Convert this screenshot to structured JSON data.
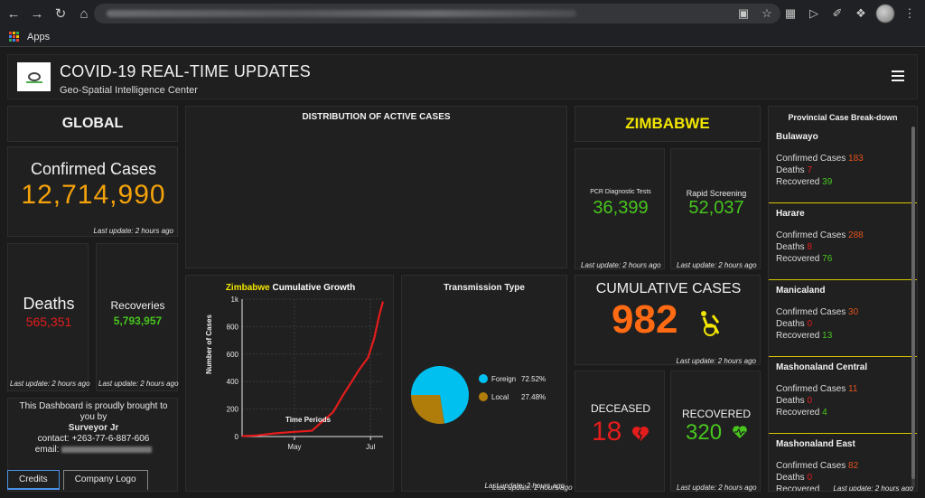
{
  "browser": {
    "apps_label": "Apps",
    "nav_icons": [
      "back-icon",
      "forward-icon",
      "reload-icon",
      "home-icon"
    ]
  },
  "header": {
    "title": "COVID-19 REAL-TIME UPDATES",
    "subtitle": "Geo-Spatial Intelligence Center"
  },
  "global": {
    "title": "GLOBAL",
    "confirmed_label": "Confirmed Cases",
    "confirmed_value": "12,714,990",
    "confirmed_update": "Last update: 2 hours ago",
    "deaths_label": "Deaths",
    "deaths_value": "565,351",
    "deaths_update": "Last update: 2 hours ago",
    "recoveries_label": "Recoveries",
    "recoveries_value": "5,793,957",
    "recoveries_update": "Last update: 2 hours ago"
  },
  "credits": {
    "line1": "This Dashboard is proudly brought to you by",
    "author": "Surveyor Jr",
    "contact": "contact: +263-77-6-887-606",
    "email_label": "email:",
    "tabs": [
      "Credits",
      "Company Logo"
    ]
  },
  "distribution": {
    "title": "DISTRIBUTION OF ACTIVE CASES"
  },
  "growth": {
    "title_highlight": "Zimbabwe",
    "title_rest": "Cumulative Growth",
    "ylabel": "Number of Cases",
    "xlabel": "Time Periods"
  },
  "transmission": {
    "title": "Transmission Type",
    "legend": [
      {
        "label": "Foreign",
        "pct": "72.52%",
        "color": "#00c0f0"
      },
      {
        "label": "Local",
        "pct": "27.48%",
        "color": "#b07d0a"
      }
    ]
  },
  "zimbabwe": {
    "title": "ZIMBABWE",
    "pcr_label": "PCR Diagnostic Tests",
    "pcr_value": "36,399",
    "pcr_update": "Last update: 2 hours ago",
    "rapid_label": "Rapid Screening",
    "rapid_value": "52,037",
    "rapid_update": "Last update: 2 hours ago",
    "cumulative_label": "CUMULATIVE CASES",
    "cumulative_value": "982",
    "cumulative_update": "Last update: 2 hours ago",
    "deceased_label": "DECEASED",
    "deceased_value": "18",
    "deceased_update": "Last update: 2 hours ago",
    "recovered_label": "RECOVERED",
    "recovered_value": "320",
    "recovered_update": "Last update: 2 hours ago",
    "transmission_update": "Last update: 2 hours ago"
  },
  "provincial": {
    "title": "Provincial Case Break-down",
    "confirmed_label": "Confirmed Cases",
    "deaths_label": "Deaths",
    "recovered_label": "Recovered",
    "update": "Last update: 2 hours ago",
    "items": [
      {
        "name": "Bulawayo",
        "confirmed": "183",
        "deaths": "7",
        "recovered": "39"
      },
      {
        "name": "Harare",
        "confirmed": "288",
        "deaths": "8",
        "recovered": "76"
      },
      {
        "name": "Manicaland",
        "confirmed": "30",
        "deaths": "0",
        "recovered": "13"
      },
      {
        "name": "Mashonaland Central",
        "confirmed": "11",
        "deaths": "0",
        "recovered": "4"
      },
      {
        "name": "Mashonaland East",
        "confirmed": "82",
        "deaths": "0",
        "recovered": ""
      }
    ]
  },
  "chart_data": [
    {
      "type": "line",
      "title": "Zimbabwe Cumulative Growth",
      "xlabel": "Time Periods",
      "ylabel": "Number of Cases",
      "x_ticks": [
        "May",
        "Jul"
      ],
      "y_ticks": [
        "0",
        "200",
        "400",
        "600",
        "800",
        "1k"
      ],
      "ylim": [
        0,
        1000
      ],
      "x": [
        "2020-03-20",
        "2020-04-01",
        "2020-04-15",
        "2020-05-01",
        "2020-05-15",
        "2020-06-01",
        "2020-06-08",
        "2020-06-15",
        "2020-06-22",
        "2020-06-29",
        "2020-07-04",
        "2020-07-08",
        "2020-07-11"
      ],
      "xlim": [
        "2020-03-20",
        "2020-07-11"
      ],
      "x_tick_positions": [
        "2020-05-01",
        "2020-07-01"
      ],
      "series": [
        {
          "values": [
            3,
            8,
            23,
            34,
            42,
            178,
            287,
            387,
            489,
            574,
            716,
            885,
            982
          ],
          "color": "#e51c1c"
        }
      ]
    },
    {
      "type": "pie",
      "title": "Transmission Type",
      "categories": [
        "Foreign",
        "Local"
      ],
      "values": [
        72.52,
        27.48
      ],
      "colors": [
        "#00c0f0",
        "#b07d0a"
      ],
      "legend": "right"
    }
  ]
}
